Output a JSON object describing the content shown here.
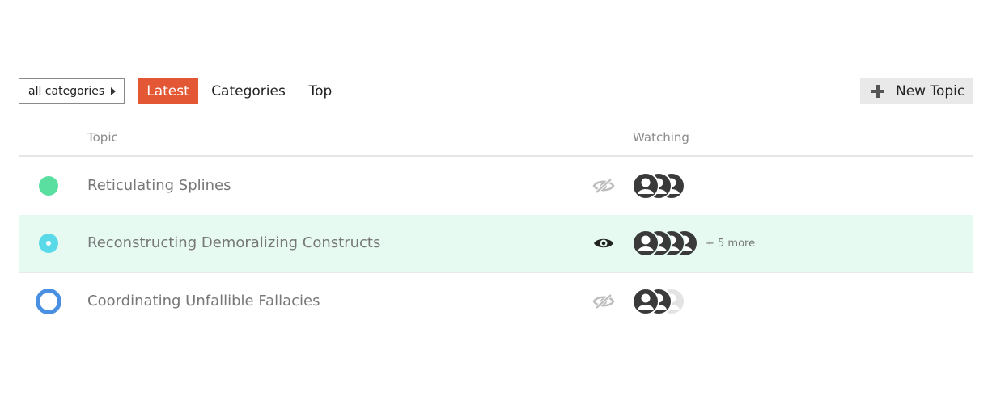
{
  "toolbar": {
    "category_dropdown": "all categories",
    "tabs": [
      "Latest",
      "Categories",
      "Top"
    ],
    "active_tab": "Latest",
    "new_topic": "New Topic"
  },
  "table": {
    "headers": {
      "topic": "Topic",
      "watching": "Watching"
    },
    "rows": [
      {
        "title": "Reticulating Splines",
        "status_icon": "status-dot-icon",
        "status_color": "#5adfa0",
        "watch_icon": "eye-slash-icon",
        "watchers_shown": 3,
        "more": ""
      },
      {
        "title": "Reconstructing Demoralizing Constructs",
        "status_icon": "status-dot-icon",
        "status_color": "#5ad9e9",
        "watch_icon": "eye-icon",
        "watchers_shown": 4,
        "more": "+ 5 more"
      },
      {
        "title": "Coordinating Unfallible Fallacies",
        "status_icon": "status-ring-icon",
        "status_color": "#4a90e2",
        "watch_icon": "eye-slash-icon",
        "watchers_shown": 3,
        "more": ""
      }
    ]
  },
  "colors": {
    "accent": "#e45735",
    "highlight_row": "#e6faf2",
    "avatar": "#3a3a3a",
    "avatar_faded": "#e3e3e3"
  }
}
